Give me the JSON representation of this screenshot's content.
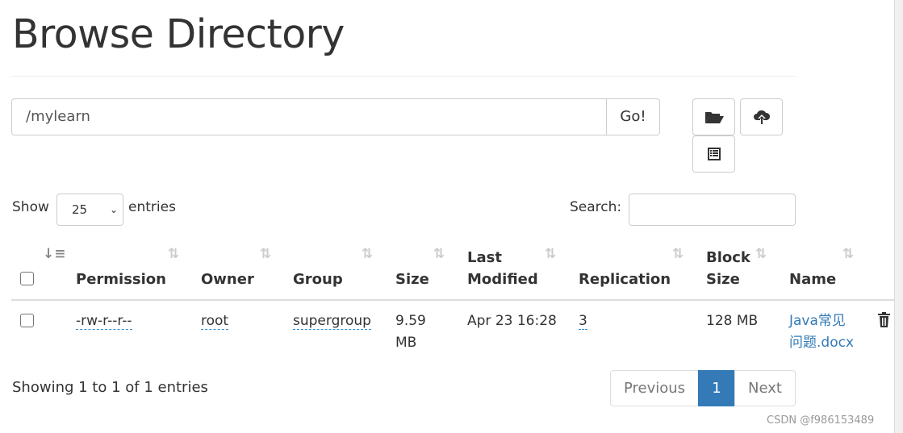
{
  "title": "Browse Directory",
  "path_input": {
    "value": "/mylearn"
  },
  "go_label": "Go!",
  "toolbar": {
    "icons": [
      "folder-open-icon",
      "cloud-upload-icon",
      "list-alt-icon"
    ]
  },
  "length": {
    "show": "Show",
    "value": "25",
    "entries": "entries"
  },
  "search": {
    "label": "Search:",
    "value": ""
  },
  "columns": [
    {
      "line1": "",
      "line2": "Permission"
    },
    {
      "line1": "",
      "line2": "Owner"
    },
    {
      "line1": "",
      "line2": "Group"
    },
    {
      "line1": "",
      "line2": "Size"
    },
    {
      "line1": "Last",
      "line2": "Modified"
    },
    {
      "line1": "",
      "line2": "Replication"
    },
    {
      "line1": "Block",
      "line2": "Size"
    },
    {
      "line1": "",
      "line2": "Name"
    }
  ],
  "rows": [
    {
      "permission": "-rw-r--r--",
      "owner": "root",
      "group": "supergroup",
      "size_1": "9.59",
      "size_2": "MB",
      "modified": "Apr 23 16:28",
      "replication": "3",
      "block_size": "128 MB",
      "name_1": "Java常见",
      "name_2": "问题.docx"
    }
  ],
  "info": "Showing 1 to 1 of 1 entries",
  "pagination": {
    "previous": "Previous",
    "current": "1",
    "next": "Next"
  },
  "colors": {
    "link": "#337ab7",
    "active_page": "#337ab7"
  },
  "watermark": "CSDN @f986153489"
}
